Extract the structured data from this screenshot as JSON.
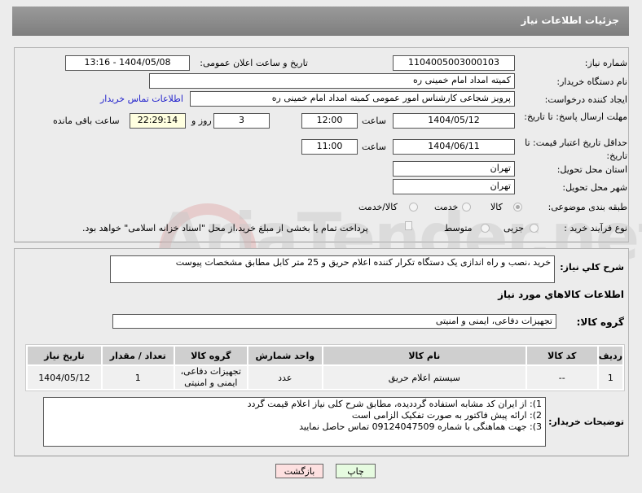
{
  "header": {
    "title": "جزئیات اطلاعات نیاز"
  },
  "fields": {
    "need_number_label": "شماره نیاز:",
    "need_number": "1104005003000103",
    "announce_label": "تاریخ و ساعت اعلان عمومی:",
    "announce_value": "1404/05/08 - 13:16",
    "buyer_org_label": "نام دستگاه خریدار:",
    "buyer_org": "کمیته امداد امام خمینی ره",
    "creator_label": "ایجاد کننده درخواست:",
    "creator": "پرویز شجاعی کارشناس امور عمومی کمیته امداد امام خمینی ره",
    "contact_link": "اطلاعات تماس خریدار",
    "deadline_label": "مهلت ارسال پاسخ: تا تاریخ:",
    "deadline_date": "1404/05/12",
    "hour_label": "ساعت",
    "deadline_time": "12:00",
    "days": "3",
    "days_label": "روز و",
    "remaining": "22:29:14",
    "remaining_label": "ساعت باقی مانده",
    "validity_label": "حداقل تاریخ اعتبار قیمت: تا تاریخ:",
    "validity_date": "1404/06/11",
    "validity_time": "11:00",
    "province_label": "استان محل تحویل:",
    "province": "تهران",
    "city_label": "شهر محل تحویل:",
    "city": "تهران",
    "category_label": "طبقه بندی موضوعی:",
    "category_options": [
      "کالا",
      "خدمت",
      "کالا/خدمت"
    ],
    "process_label": "نوع فرآیند خرید :",
    "process_options": [
      "جزیی",
      "متوسط"
    ],
    "payment_note": "پرداخت تمام یا بخشی از مبلغ خرید،از محل \"اسناد خزانه اسلامی\" خواهد بود."
  },
  "description": {
    "label": "شرح کلي نياز:",
    "value": "خرید ،نصب و راه اندازی یک دستگاه تکرار کننده اعلام حریق و 25 متر کابل مطابق مشخصات پیوست"
  },
  "goods": {
    "heading": "اطلاعات کالاهاي مورد نياز",
    "group_label": "گروه کالا:",
    "group_value": "تجهیزات دفاعی، ایمنی و امنیتی",
    "columns": [
      "ردیف",
      "کد کالا",
      "نام کالا",
      "واحد شمارش",
      "گروه کالا",
      "تعداد / مقدار",
      "تاریخ نیاز"
    ],
    "rows": [
      [
        "1",
        "--",
        "سیستم اعلام حریق",
        "عدد",
        "تجهیزات دفاعی، ایمنی و امنیتی",
        "1",
        "1404/05/12"
      ]
    ]
  },
  "notes": {
    "label": "توضیحات خریدار:",
    "lines": [
      "1): از ایران کد مشابه استفاده گرددیده، مطابق شرح کلی نیاز اعلام قیمت گردد",
      "2): ارائه پیش فاکتور به صورت تفکیک الزامی است",
      "3): جهت هماهنگی با شماره 09124047509 تماس حاصل نمایید"
    ]
  },
  "buttons": {
    "print": "چاپ",
    "back": "بازگشت"
  },
  "watermark": "AriaTender.net"
}
